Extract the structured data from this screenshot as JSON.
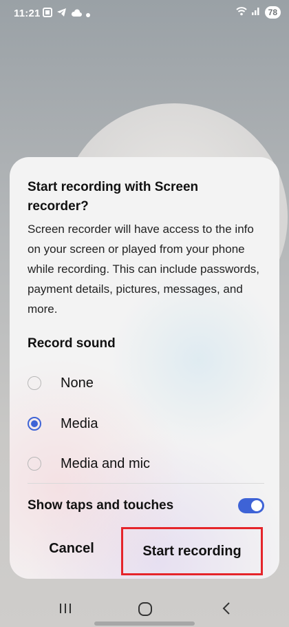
{
  "status_bar": {
    "time": "11:21",
    "battery": "78",
    "left_icons": [
      "screenshot-icon",
      "telegram-icon",
      "cloud-icon",
      "dot-icon"
    ],
    "right_icons": [
      "wifi-icon",
      "signal-icon"
    ]
  },
  "dialog": {
    "title": "Start recording with Screen recorder?",
    "description": "Screen recorder will have access to the info on your screen or played from your phone while recording. This can include passwords, payment details, pictures, messages, and more.",
    "record_sound_label": "Record sound",
    "options": [
      {
        "label": "None",
        "selected": false
      },
      {
        "label": "Media",
        "selected": true
      },
      {
        "label": "Media and mic",
        "selected": false
      }
    ],
    "show_taps_label": "Show taps and touches",
    "show_taps_enabled": true,
    "cancel_label": "Cancel",
    "start_label": "Start recording"
  },
  "colors": {
    "accent": "#3e63d6",
    "highlight": "#e5242a"
  },
  "nav": {
    "icons": [
      "recents-icon",
      "home-icon",
      "back-icon"
    ]
  }
}
